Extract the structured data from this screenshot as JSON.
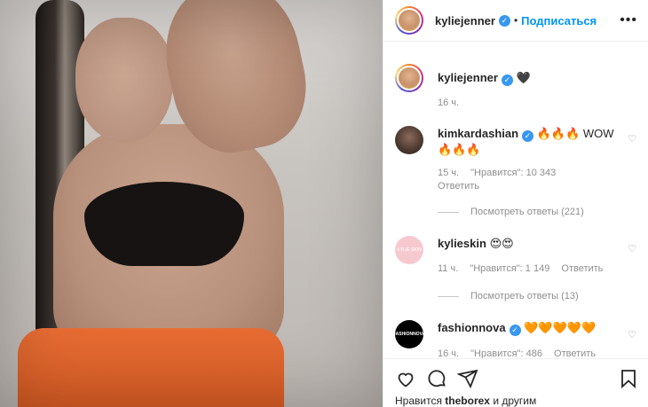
{
  "header": {
    "username": "kyliejenner",
    "separator": "•",
    "follow_label": "Подписаться",
    "more": "•••"
  },
  "caption": {
    "username": "kyliejenner",
    "text": "🖤",
    "time": "16 ч."
  },
  "comments": [
    {
      "username": "kimkardashian",
      "text": "🔥🔥🔥 WOW 🔥🔥🔥",
      "time": "15 ч.",
      "likes": "\"Нравится\": 10 343",
      "reply": "Ответить",
      "view_replies": "Посмотреть ответы (221)"
    },
    {
      "username": "kylieskin",
      "text": "😍😍",
      "time": "11 ч.",
      "likes": "\"Нравится\": 1 149",
      "reply": "Ответить",
      "view_replies": "Посмотреть ответы (13)",
      "avatar_text": "KYLIE SKIN"
    },
    {
      "username": "fashionnova",
      "text": "🧡🧡🧡🧡🧡",
      "time": "16 ч.",
      "likes": "\"Нравится\": 486",
      "reply": "Ответить",
      "avatar_text": "FASHIONNOVA"
    }
  ],
  "liked_by": {
    "prefix": "Нравится",
    "user": "theborex",
    "suffix": "и другим"
  },
  "icons": {
    "like": "heart-icon",
    "comment": "comment-icon",
    "share": "share-icon",
    "save": "bookmark-icon",
    "comment_like": "heart-outline-icon",
    "verified": "verified-badge-icon"
  },
  "colors": {
    "accent": "#0095f6",
    "verified": "#3897f0",
    "muted": "#8e8e8e"
  }
}
